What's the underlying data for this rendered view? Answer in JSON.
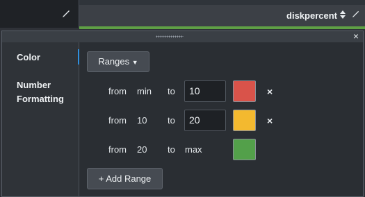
{
  "header": {
    "column_title": "diskpercent"
  },
  "sidebar": {
    "items": [
      {
        "label": "Color"
      },
      {
        "label": "Number"
      },
      {
        "label": "Formatting"
      }
    ]
  },
  "content": {
    "ranges_label": "Ranges",
    "add_range_label": "+ Add Range",
    "from_label": "from",
    "to_label": "to",
    "remove_label": "×",
    "close_label": "×",
    "rows": [
      {
        "from": "min",
        "to": "10",
        "color": "#d9534a"
      },
      {
        "from": "10",
        "to": "20",
        "color": "#f3b92f"
      },
      {
        "from": "20",
        "to": "max",
        "color": "#53a04a"
      }
    ]
  },
  "colors": {
    "accent": "#2f8fdd",
    "header_green": "#5fa045"
  }
}
